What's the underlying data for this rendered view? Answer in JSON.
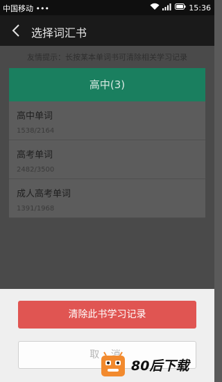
{
  "statusbar": {
    "carrier": "中国移动 •••",
    "time": "15:36"
  },
  "appbar": {
    "title": "选择词汇书",
    "back_icon": "chevron-left-icon"
  },
  "tip": "友情提示：长按某本单词书可清除相关学习记录",
  "category": {
    "label": "高中(3)"
  },
  "books": [
    {
      "name": "高中单词",
      "progress": "1538/2164"
    },
    {
      "name": "高考单词",
      "progress": "2482/3500"
    },
    {
      "name": "成人高考单词",
      "progress": "1391/1968"
    }
  ],
  "sheet": {
    "clear_label": "清除此书学习记录",
    "cancel_label": "取 消"
  },
  "watermark": {
    "text": "80后下载"
  },
  "colors": {
    "green": "#1a7f5f",
    "red": "#e05552"
  }
}
